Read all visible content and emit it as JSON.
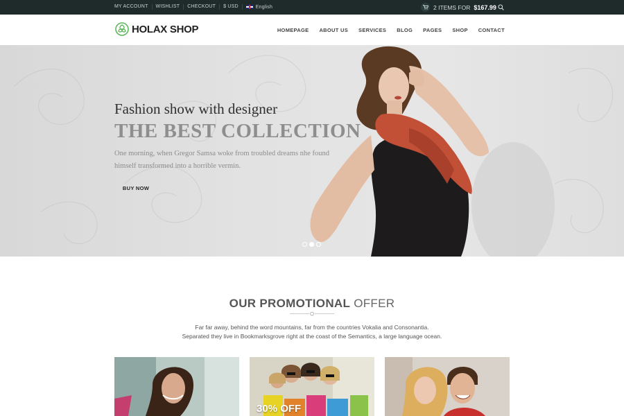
{
  "topbar": {
    "links": [
      "MY ACCOUNT",
      "WISHLIST",
      "CHECKOUT",
      "$ USD"
    ],
    "language": "English",
    "cart_items_text": "2 ITEMS FOR",
    "cart_total": "$167.99"
  },
  "header": {
    "logo_text": "HOLAX SHOP",
    "nav": [
      "HOMEPAGE",
      "ABOUT US",
      "SERVICES",
      "BLOG",
      "PAGES",
      "SHOP",
      "CONTACT"
    ]
  },
  "hero": {
    "subtitle": "Fashion show with designer",
    "title": "THE BEST COLLECTION",
    "description": "One morning, when Gregor Samsa woke from troubled dreams nhe found himself transformed into a horrible vermin.",
    "button": "BUY NOW",
    "slides_total": 3,
    "active_slide": 2
  },
  "promo": {
    "title_bold": "OUR PROMOTIONAL",
    "title_light": "OFFER",
    "text_line1": "Far far away, behind the word mountains, far from the countries Vokalia and Consonantia.",
    "text_line2": "Separated they live in Bookmarksgrove right at the coast of the Semantics, a large language ocean.",
    "cards": [
      {
        "label": ""
      },
      {
        "label": "30% OFF"
      },
      {
        "label": ""
      }
    ]
  },
  "colors": {
    "topbar_bg": "#1f2b2b",
    "logo_green": "#5cb85c"
  }
}
